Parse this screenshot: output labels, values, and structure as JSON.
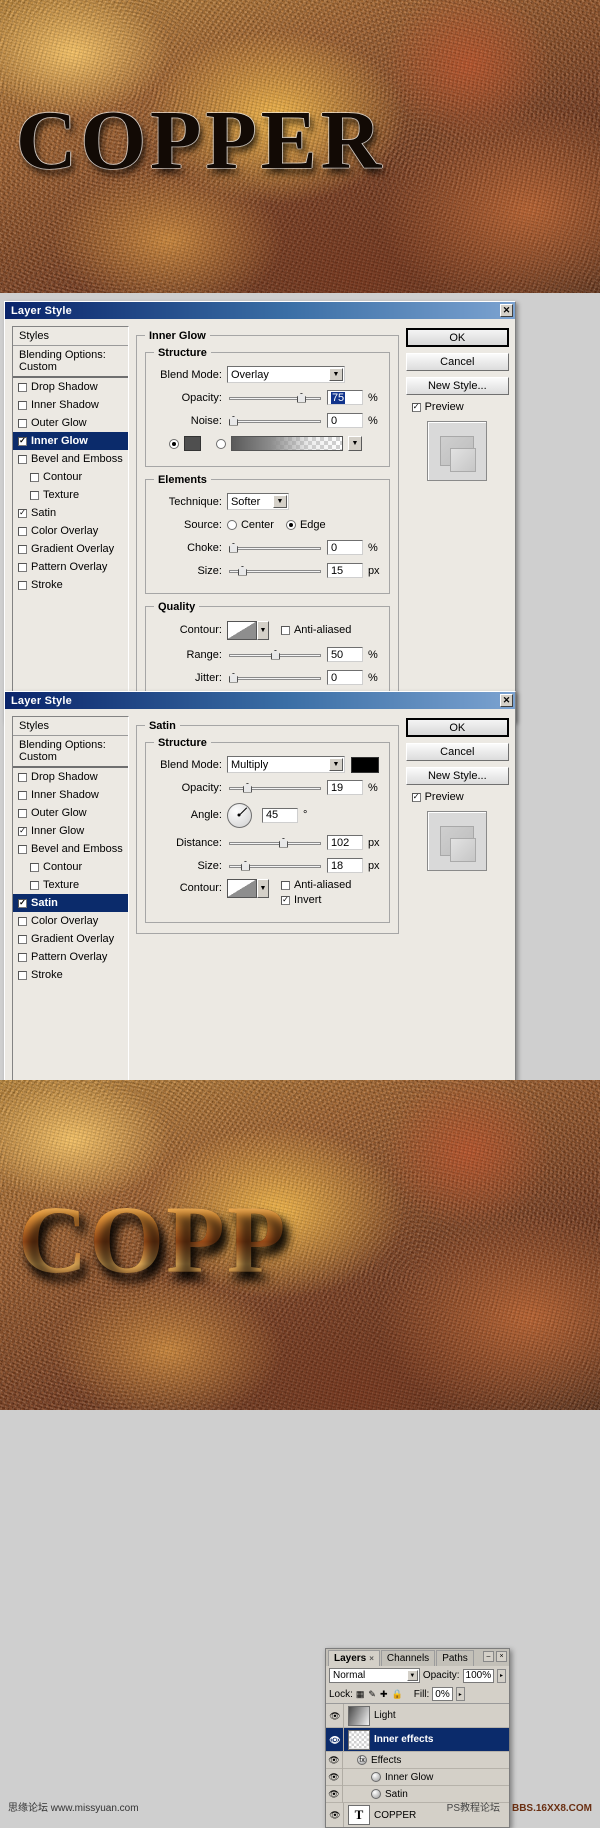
{
  "hero": {
    "title": "COPPER"
  },
  "result": {
    "title": "COPP"
  },
  "dialog1": {
    "title": "Layer Style",
    "close": "✕",
    "styles_header": "Styles",
    "blending_options": "Blending Options: Custom",
    "effects": [
      {
        "label": "Drop Shadow",
        "checked": false,
        "indent": false,
        "selected": false
      },
      {
        "label": "Inner Shadow",
        "checked": false,
        "indent": false,
        "selected": false
      },
      {
        "label": "Outer Glow",
        "checked": false,
        "indent": false,
        "selected": false
      },
      {
        "label": "Inner Glow",
        "checked": true,
        "indent": false,
        "selected": true
      },
      {
        "label": "Bevel and Emboss",
        "checked": false,
        "indent": false,
        "selected": false
      },
      {
        "label": "Contour",
        "checked": false,
        "indent": true,
        "selected": false
      },
      {
        "label": "Texture",
        "checked": false,
        "indent": true,
        "selected": false
      },
      {
        "label": "Satin",
        "checked": true,
        "indent": false,
        "selected": false
      },
      {
        "label": "Color Overlay",
        "checked": false,
        "indent": false,
        "selected": false
      },
      {
        "label": "Gradient Overlay",
        "checked": false,
        "indent": false,
        "selected": false
      },
      {
        "label": "Pattern Overlay",
        "checked": false,
        "indent": false,
        "selected": false
      },
      {
        "label": "Stroke",
        "checked": false,
        "indent": false,
        "selected": false
      }
    ],
    "panel_title": "Inner Glow",
    "structure_legend": "Structure",
    "blend_mode_label": "Blend Mode:",
    "blend_mode_value": "Overlay",
    "opacity_label": "Opacity:",
    "opacity_value": "75",
    "opacity_unit": "%",
    "noise_label": "Noise:",
    "noise_value": "0",
    "noise_unit": "%",
    "glow_color": "#4f4f4f",
    "elements_legend": "Elements",
    "technique_label": "Technique:",
    "technique_value": "Softer",
    "source_label": "Source:",
    "source_center": "Center",
    "source_edge": "Edge",
    "choke_label": "Choke:",
    "choke_value": "0",
    "choke_unit": "%",
    "size_label": "Size:",
    "size_value": "15",
    "size_unit": "px",
    "quality_legend": "Quality",
    "contour_label": "Contour:",
    "anti_aliased": "Anti-aliased",
    "range_label": "Range:",
    "range_value": "50",
    "range_unit": "%",
    "jitter_label": "Jitter:",
    "jitter_value": "0",
    "jitter_unit": "%",
    "btn_ok": "OK",
    "btn_cancel": "Cancel",
    "btn_new_style": "New Style...",
    "preview_label": "Preview"
  },
  "dialog2": {
    "title": "Layer Style",
    "close": "✕",
    "styles_header": "Styles",
    "blending_options": "Blending Options: Custom",
    "effects": [
      {
        "label": "Drop Shadow",
        "checked": false,
        "indent": false,
        "selected": false
      },
      {
        "label": "Inner Shadow",
        "checked": false,
        "indent": false,
        "selected": false
      },
      {
        "label": "Outer Glow",
        "checked": false,
        "indent": false,
        "selected": false
      },
      {
        "label": "Inner Glow",
        "checked": true,
        "indent": false,
        "selected": false
      },
      {
        "label": "Bevel and Emboss",
        "checked": false,
        "indent": false,
        "selected": false
      },
      {
        "label": "Contour",
        "checked": false,
        "indent": true,
        "selected": false
      },
      {
        "label": "Texture",
        "checked": false,
        "indent": true,
        "selected": false
      },
      {
        "label": "Satin",
        "checked": true,
        "indent": false,
        "selected": true
      },
      {
        "label": "Color Overlay",
        "checked": false,
        "indent": false,
        "selected": false
      },
      {
        "label": "Gradient Overlay",
        "checked": false,
        "indent": false,
        "selected": false
      },
      {
        "label": "Pattern Overlay",
        "checked": false,
        "indent": false,
        "selected": false
      },
      {
        "label": "Stroke",
        "checked": false,
        "indent": false,
        "selected": false
      }
    ],
    "panel_title": "Satin",
    "structure_legend": "Structure",
    "blend_mode_label": "Blend Mode:",
    "blend_mode_value": "Multiply",
    "satin_color": "#000000",
    "opacity_label": "Opacity:",
    "opacity_value": "19",
    "opacity_unit": "%",
    "angle_label": "Angle:",
    "angle_value": "45",
    "angle_unit": "°",
    "distance_label": "Distance:",
    "distance_value": "102",
    "distance_unit": "px",
    "size_label": "Size:",
    "size_value": "18",
    "size_unit": "px",
    "contour_label": "Contour:",
    "anti_aliased": "Anti-aliased",
    "invert": "Invert",
    "btn_ok": "OK",
    "btn_cancel": "Cancel",
    "btn_new_style": "New Style...",
    "preview_label": "Preview"
  },
  "layers_panel": {
    "tabs": [
      {
        "label": "Layers",
        "active": true,
        "close": "×"
      },
      {
        "label": "Channels",
        "active": false,
        "close": ""
      },
      {
        "label": "Paths",
        "active": false,
        "close": ""
      }
    ],
    "minimize": "–",
    "close": "×",
    "menu": "▸",
    "blend_mode": "Normal",
    "opacity_label": "Opacity:",
    "opacity_value": "100%",
    "lock_label": "Lock:",
    "fill_label": "Fill:",
    "fill_value": "0%",
    "lock_icons": [
      "▦",
      "✎",
      "✢",
      "ὑ2"
    ],
    "rows": [
      {
        "type": "layer",
        "name": "Light",
        "thumb": "grad",
        "selected": false,
        "visible": true
      },
      {
        "type": "layer",
        "name": "Inner effects",
        "thumb": "checker",
        "selected": true,
        "visible": true
      },
      {
        "type": "fx-head",
        "name": "Effects",
        "visible": true
      },
      {
        "type": "fx",
        "name": "Inner Glow",
        "visible": true
      },
      {
        "type": "fx",
        "name": "Satin",
        "visible": true
      },
      {
        "type": "layer",
        "name": "COPPER",
        "thumb": "T",
        "selected": false,
        "visible": true
      }
    ]
  },
  "footer": {
    "left": "思缘论坛   www.missyuan.com",
    "mid": "PS教程论坛",
    "right": "BBS.16XX8.COM"
  }
}
